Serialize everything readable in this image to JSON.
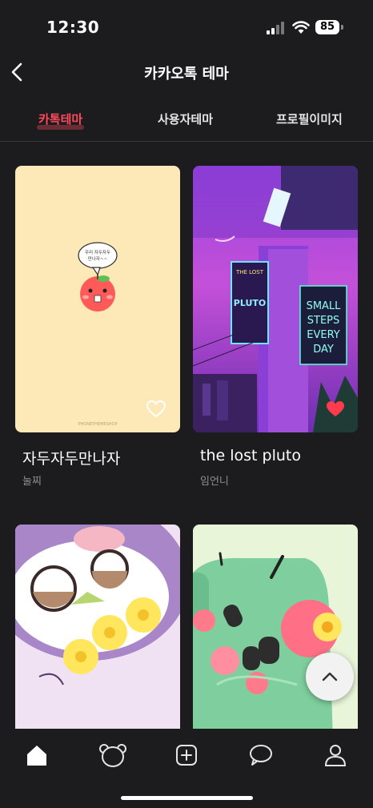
{
  "status": {
    "time": "12:30",
    "battery": "85"
  },
  "header": {
    "title": "카카오톡 테마"
  },
  "tabs": [
    {
      "label": "카톡테마",
      "active": true
    },
    {
      "label": "사용자테마",
      "active": false
    },
    {
      "label": "프로필이미지",
      "active": false
    }
  ],
  "cards": [
    {
      "title": "자두자두만나자",
      "author": "눌찌",
      "bubble_lines": [
        "우리 자두자두",
        "만나자~~"
      ],
      "watermark": "PHONETHEMESHOP",
      "liked": false
    },
    {
      "title": "the lost pluto",
      "author": "임언니",
      "sign_top": "THE LOST",
      "sign_word": "PLUTO",
      "neon_lines": [
        "SMALL",
        "STEPS",
        "EVERY",
        "DAY"
      ],
      "liked": true
    },
    {
      "title": "",
      "author": ""
    },
    {
      "title": "",
      "author": ""
    }
  ],
  "colors": {
    "accent": "#ff4a5e",
    "background": "#1c1c1e",
    "like": "#ff3b4e"
  },
  "nav": [
    {
      "icon": "home-icon",
      "active": true
    },
    {
      "icon": "bear-icon",
      "active": false
    },
    {
      "icon": "add-icon",
      "active": false
    },
    {
      "icon": "chat-icon",
      "active": false
    },
    {
      "icon": "profile-icon",
      "active": false
    }
  ]
}
